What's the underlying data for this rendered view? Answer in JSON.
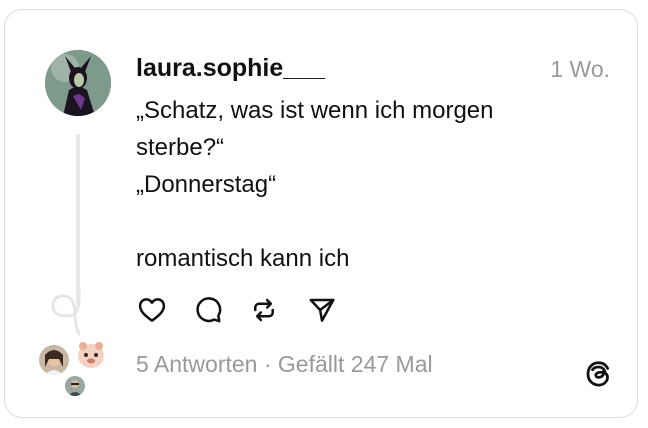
{
  "post": {
    "username": "laura.sophie___",
    "time": "1 Wo.",
    "text": "„Schatz, was ist wenn ich morgen\nsterbe?“\n„Donnerstag“\n\nromantisch kann ich"
  },
  "actions": {
    "like_icon": "heart-icon",
    "reply_icon": "comment-icon",
    "repost_icon": "repost-icon",
    "share_icon": "send-icon"
  },
  "meta": {
    "replies": "5 Antworten",
    "separator": " · ",
    "likes": "Gefällt 247 Mal"
  },
  "colors": {
    "text": "#111111",
    "muted": "#999999",
    "border": "#dcdcdc",
    "thread_line": "#e6e6e6"
  }
}
